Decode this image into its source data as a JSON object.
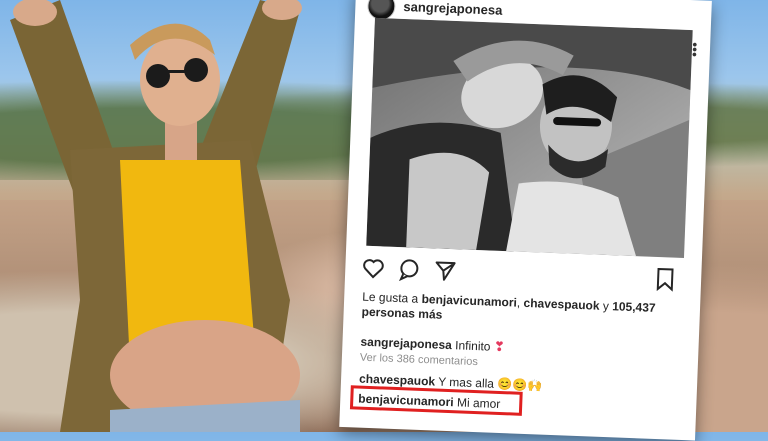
{
  "post": {
    "username": "sangrejaponesa",
    "likes_prefix": "Le gusta a",
    "liked_by_1": "benjavicunamori",
    "liked_by_2": "chavespauok",
    "likes_and": "y",
    "likes_count": "105,437",
    "likes_suffix": "personas más",
    "caption_user": "sangrejaponesa",
    "caption_text": "Infinito",
    "view_comments": "Ver los 386 comentarios"
  },
  "comments": [
    {
      "user": "chavespauok",
      "text": "Y mas alla"
    },
    {
      "user": "benjavicunamori",
      "text": "Mi amor"
    }
  ],
  "icons": {
    "like": "heart-outline-icon",
    "comment": "comment-bubble-icon",
    "share": "paper-plane-icon",
    "save": "bookmark-icon",
    "more": "vertical-dots-icon",
    "caption_emoji": "pink-heart",
    "comment_emoji": "smile-faces-and-raised-hands"
  },
  "colors": {
    "highlight_box": "#e02020",
    "muted_text": "#8e8e8e",
    "heart": "#e4395e"
  }
}
